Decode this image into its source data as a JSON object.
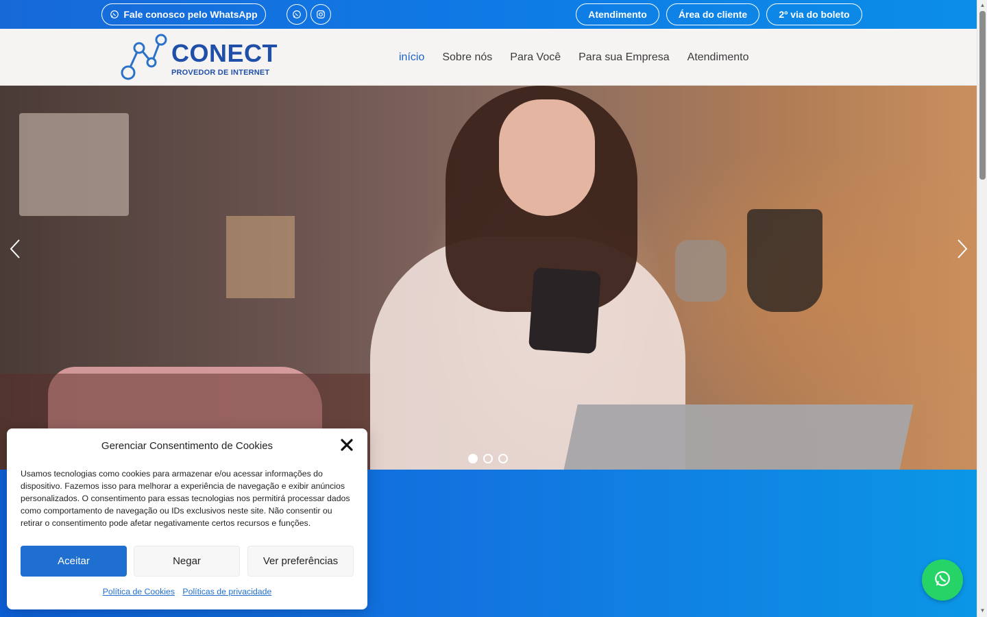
{
  "topbar": {
    "whatsapp_label": "Fale conosco pelo WhatsApp",
    "buttons": [
      "Atendimento",
      "Área do cliente",
      "2º via do boleto"
    ],
    "social_icons": [
      "whatsapp-icon",
      "instagram-icon"
    ]
  },
  "logo": {
    "word": "CONECT",
    "subtitle": "PROVEDOR DE INTERNET"
  },
  "nav": {
    "items": [
      {
        "label": "início",
        "active": true
      },
      {
        "label": "Sobre nós",
        "active": false
      },
      {
        "label": "Para Você",
        "active": false
      },
      {
        "label": "Para sua Empresa",
        "active": false
      },
      {
        "label": "Atendimento",
        "active": false
      }
    ]
  },
  "hero": {
    "slides_total": 3,
    "active_slide": 1
  },
  "cookie": {
    "title": "Gerenciar Consentimento de Cookies",
    "text": "Usamos tecnologias como cookies para armazenar e/ou acessar informações do dispositivo. Fazemos isso para melhorar a experiência de navegação e exibir anúncios personalizados. O consentimento para essas tecnologias nos permitirá processar dados como comportamento de navegação ou IDs exclusivos neste site. Não consentir ou retirar o consentimento pode afetar negativamente certos recursos e funções.",
    "accept": "Aceitar",
    "deny": "Negar",
    "preferences": "Ver preferências",
    "link_cookies": "Política de Cookies",
    "link_privacy": "Políticas de privacidade"
  },
  "colors": {
    "brand_blue": "#1f4fa8",
    "accent_blue": "#1e6fcf",
    "whatsapp_green": "#25d366"
  }
}
